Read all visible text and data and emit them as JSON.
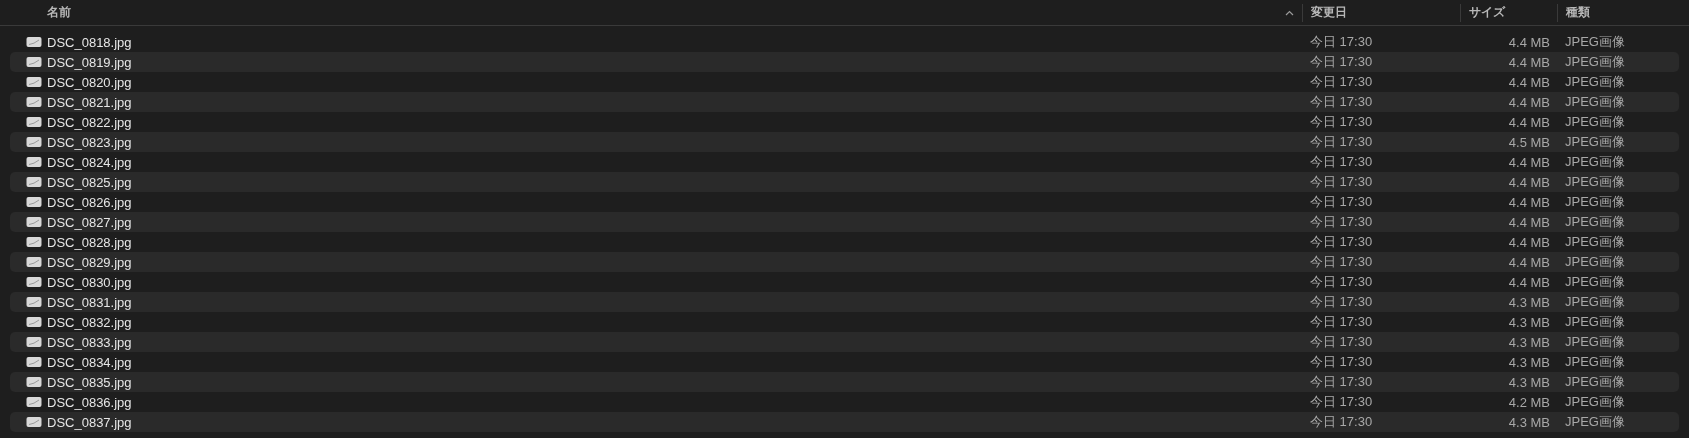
{
  "columns": [
    {
      "label": "名前",
      "sorted": true
    },
    {
      "label": "変更日",
      "sorted": false
    },
    {
      "label": "サイズ",
      "sorted": false
    },
    {
      "label": "種類",
      "sorted": false
    }
  ],
  "rows": [
    {
      "name": "DSC_0818.jpg",
      "date": "今日 17:30",
      "size": "4.4 MB",
      "kind": "JPEG画像"
    },
    {
      "name": "DSC_0819.jpg",
      "date": "今日 17:30",
      "size": "4.4 MB",
      "kind": "JPEG画像"
    },
    {
      "name": "DSC_0820.jpg",
      "date": "今日 17:30",
      "size": "4.4 MB",
      "kind": "JPEG画像"
    },
    {
      "name": "DSC_0821.jpg",
      "date": "今日 17:30",
      "size": "4.4 MB",
      "kind": "JPEG画像"
    },
    {
      "name": "DSC_0822.jpg",
      "date": "今日 17:30",
      "size": "4.4 MB",
      "kind": "JPEG画像"
    },
    {
      "name": "DSC_0823.jpg",
      "date": "今日 17:30",
      "size": "4.5 MB",
      "kind": "JPEG画像"
    },
    {
      "name": "DSC_0824.jpg",
      "date": "今日 17:30",
      "size": "4.4 MB",
      "kind": "JPEG画像"
    },
    {
      "name": "DSC_0825.jpg",
      "date": "今日 17:30",
      "size": "4.4 MB",
      "kind": "JPEG画像"
    },
    {
      "name": "DSC_0826.jpg",
      "date": "今日 17:30",
      "size": "4.4 MB",
      "kind": "JPEG画像"
    },
    {
      "name": "DSC_0827.jpg",
      "date": "今日 17:30",
      "size": "4.4 MB",
      "kind": "JPEG画像"
    },
    {
      "name": "DSC_0828.jpg",
      "date": "今日 17:30",
      "size": "4.4 MB",
      "kind": "JPEG画像"
    },
    {
      "name": "DSC_0829.jpg",
      "date": "今日 17:30",
      "size": "4.4 MB",
      "kind": "JPEG画像"
    },
    {
      "name": "DSC_0830.jpg",
      "date": "今日 17:30",
      "size": "4.4 MB",
      "kind": "JPEG画像"
    },
    {
      "name": "DSC_0831.jpg",
      "date": "今日 17:30",
      "size": "4.3 MB",
      "kind": "JPEG画像"
    },
    {
      "name": "DSC_0832.jpg",
      "date": "今日 17:30",
      "size": "4.3 MB",
      "kind": "JPEG画像"
    },
    {
      "name": "DSC_0833.jpg",
      "date": "今日 17:30",
      "size": "4.3 MB",
      "kind": "JPEG画像"
    },
    {
      "name": "DSC_0834.jpg",
      "date": "今日 17:30",
      "size": "4.3 MB",
      "kind": "JPEG画像"
    },
    {
      "name": "DSC_0835.jpg",
      "date": "今日 17:30",
      "size": "4.3 MB",
      "kind": "JPEG画像"
    },
    {
      "name": "DSC_0836.jpg",
      "date": "今日 17:30",
      "size": "4.2 MB",
      "kind": "JPEG画像"
    },
    {
      "name": "DSC_0837.jpg",
      "date": "今日 17:30",
      "size": "4.3 MB",
      "kind": "JPEG画像"
    }
  ]
}
